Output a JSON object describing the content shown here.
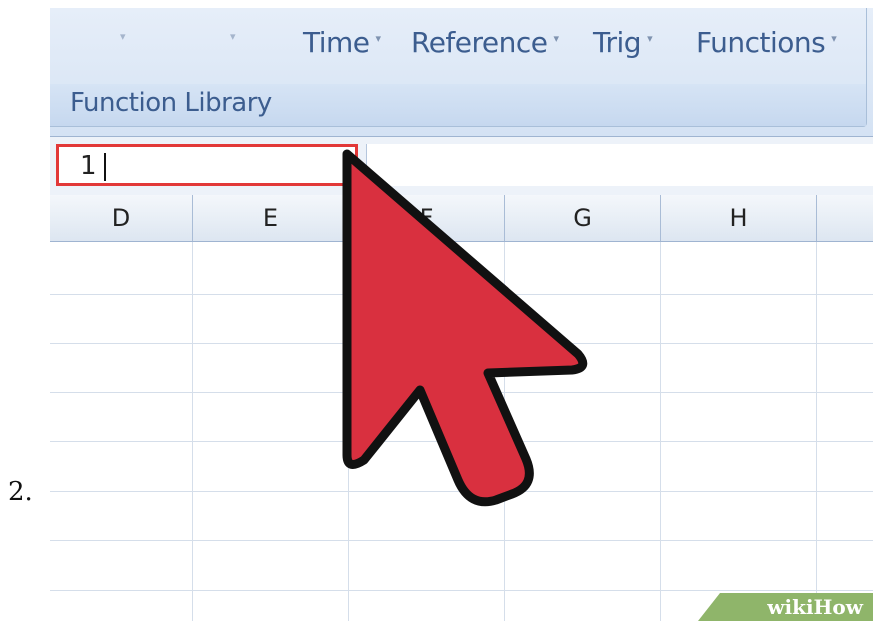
{
  "step_number": "2.",
  "ribbon": {
    "buttons": [
      {
        "label": "Time",
        "caret": "▾"
      },
      {
        "label": "Reference",
        "caret": "▾"
      },
      {
        "label": "Trig",
        "caret": "▾"
      },
      {
        "label": "Functions",
        "caret": "▾"
      }
    ],
    "group_label": "Function Library"
  },
  "name_box": {
    "value": "1"
  },
  "columns": [
    "D",
    "E",
    "F",
    "G",
    "H"
  ],
  "watermark": "wikiHow",
  "colors": {
    "name_box_highlight": "#e23838",
    "arrow_fill": "#d9303f",
    "ribbon_text": "#3c5d8f"
  }
}
